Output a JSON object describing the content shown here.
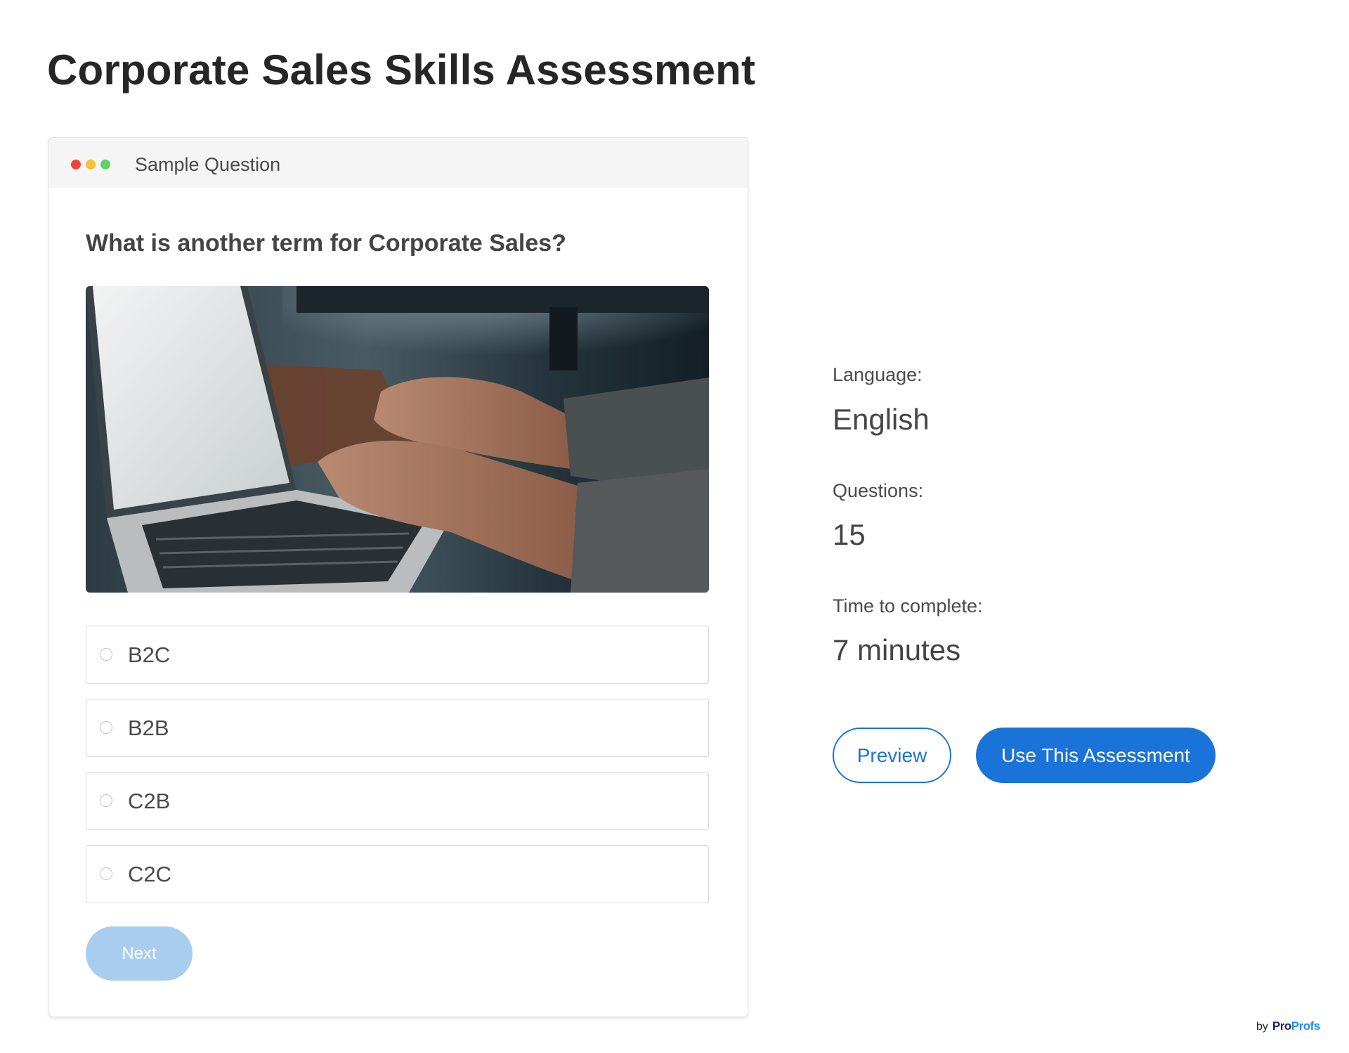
{
  "page": {
    "title": "Corporate Sales Skills Assessment"
  },
  "card": {
    "header_label": "Sample Question",
    "window_dots": [
      "red",
      "yellow",
      "green"
    ],
    "question": "What is another term for Corporate Sales?",
    "image_icon": "laptop-typing-photo",
    "options": [
      {
        "label": "B2C",
        "selected": false
      },
      {
        "label": "B2B",
        "selected": false
      },
      {
        "label": "C2B",
        "selected": false
      },
      {
        "label": "C2C",
        "selected": false
      }
    ],
    "next_label": "Next"
  },
  "info": {
    "language_label": "Language:",
    "language_value": "English",
    "questions_label": "Questions:",
    "questions_value": "15",
    "time_label": "Time to complete:",
    "time_value": "7 minutes"
  },
  "actions": {
    "preview_label": "Preview",
    "use_label": "Use This Assessment"
  },
  "branding": {
    "by": "by",
    "logo_part1": "Pro",
    "logo_part2": "Profs"
  },
  "colors": {
    "accent": "#1a73d9",
    "next_disabled": "#a9cdef",
    "dot_red": "#f44336",
    "dot_yellow": "#f7c136",
    "dot_green": "#5fd068"
  }
}
